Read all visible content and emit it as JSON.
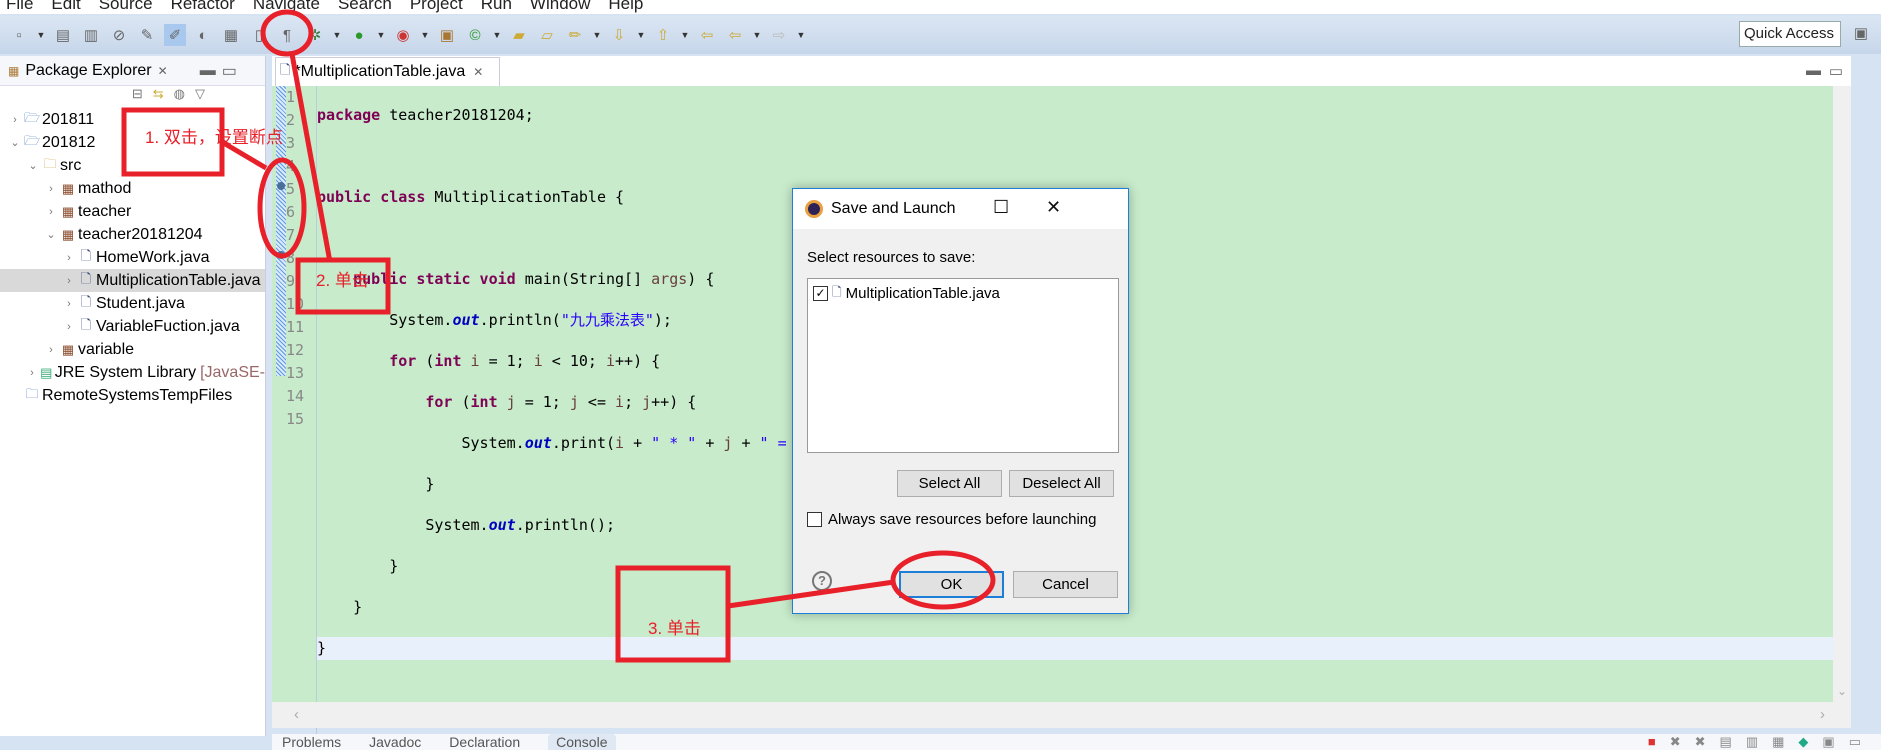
{
  "menu": [
    "File",
    "Edit",
    "Source",
    "Refactor",
    "Navigate",
    "Search",
    "Project",
    "Run",
    "Window",
    "Help"
  ],
  "toolbar": {
    "quick_access": "Quick Access"
  },
  "package_explorer": {
    "title": "Package Explorer",
    "tree": [
      {
        "label": "201811",
        "depth": 0,
        "twisty": "›",
        "icon": "project-icon"
      },
      {
        "label": "201812",
        "depth": 0,
        "twisty": "⌄",
        "icon": "project-icon"
      },
      {
        "label": "src",
        "depth": 1,
        "twisty": "⌄",
        "icon": "source-folder-icon"
      },
      {
        "label": "mathod",
        "depth": 2,
        "twisty": "›",
        "icon": "package-icon"
      },
      {
        "label": "teacher",
        "depth": 2,
        "twisty": "›",
        "icon": "package-icon"
      },
      {
        "label": "teacher20181204",
        "depth": 2,
        "twisty": "⌄",
        "icon": "package-icon"
      },
      {
        "label": "HomeWork.java",
        "depth": 3,
        "twisty": "›",
        "icon": "java-file-icon"
      },
      {
        "label": "MultiplicationTable.java",
        "depth": 3,
        "twisty": "›",
        "icon": "java-file-icon",
        "selected": true
      },
      {
        "label": "Student.java",
        "depth": 3,
        "twisty": "›",
        "icon": "java-file-icon"
      },
      {
        "label": "VariableFuction.java",
        "depth": 3,
        "twisty": "›",
        "icon": "java-file-icon"
      },
      {
        "label": "variable",
        "depth": 2,
        "twisty": "›",
        "icon": "package-icon"
      },
      {
        "label": "JRE System Library",
        "suffix": "[JavaSE-",
        "depth": 1,
        "twisty": "›",
        "icon": "library-icon"
      },
      {
        "label": "RemoteSystemsTempFiles",
        "depth": 0,
        "twisty": "",
        "icon": "folder-icon"
      }
    ]
  },
  "editor": {
    "tab": "*MultiplicationTable.java",
    "line_numbers": [
      "1",
      "2",
      "3",
      "4",
      "5",
      "6",
      "7",
      "8",
      "9",
      "10",
      "11",
      "12",
      "13",
      "14",
      "15"
    ],
    "breakpoint_lines": [
      5,
      8
    ],
    "current_line": 14
  },
  "bottom_tabs": [
    "Problems",
    "Javadoc",
    "Declaration",
    "Console"
  ],
  "dialog": {
    "title": "Save and Launch",
    "prompt": "Select resources to save:",
    "resource": "MultiplicationTable.java",
    "resource_checked": true,
    "select_all": "Select All",
    "deselect_all": "Deselect All",
    "always_save": "Always save resources before launching",
    "always_save_checked": false,
    "ok": "OK",
    "cancel": "Cancel"
  },
  "annotations": {
    "step1": "1. 双击，设置断点",
    "step2": "2. 单击",
    "step3": "3. 单击",
    "color": "#e8202a"
  }
}
